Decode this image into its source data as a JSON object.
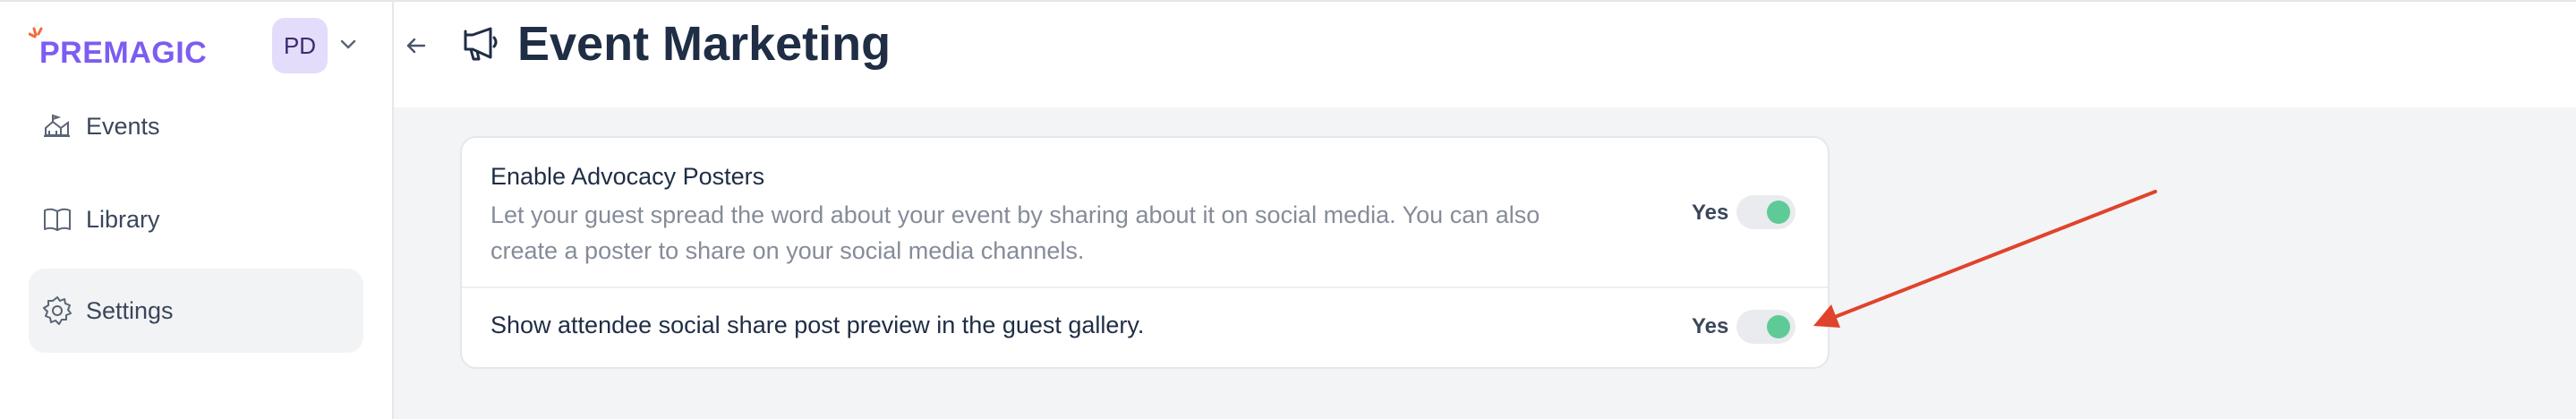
{
  "app": {
    "logo_text": "PREMAGIC",
    "avatar_initials": "PD"
  },
  "sidebar": {
    "items": [
      {
        "label": "Events",
        "icon": "events-icon",
        "active": false
      },
      {
        "label": "Library",
        "icon": "book-icon",
        "active": false
      },
      {
        "label": "Settings",
        "icon": "gear-icon",
        "active": true
      }
    ]
  },
  "header": {
    "title": "Event Marketing",
    "title_icon": "megaphone-icon",
    "back_icon": "arrow-left-icon"
  },
  "settings": [
    {
      "title": "Enable Advocacy Posters",
      "description": "Let your guest spread the word about your event by sharing about it on social media. You can also create a poster to share on your social media channels.",
      "value_label": "Yes",
      "enabled": true
    },
    {
      "title": "Show attendee social share post preview in the guest gallery.",
      "value_label": "Yes",
      "enabled": true
    }
  ],
  "colors": {
    "brand": "#7c5cf2",
    "toggle_on": "#5ecb97",
    "annotation_arrow": "#e0432b"
  }
}
